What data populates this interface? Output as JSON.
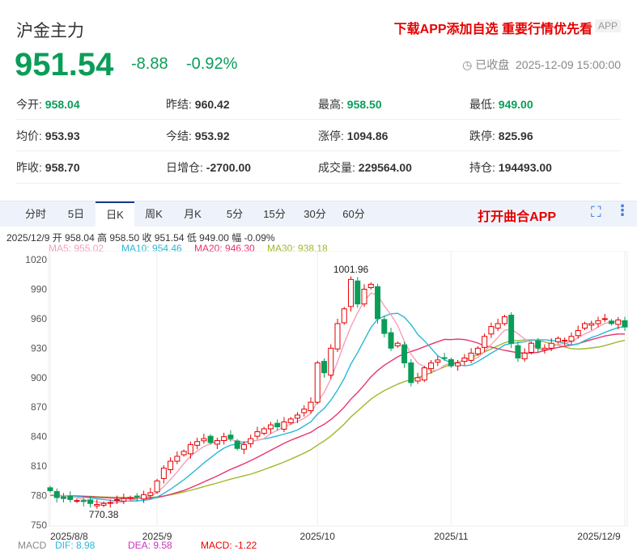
{
  "header": {
    "title": "沪金主力",
    "promo": "下载APP添加自选 重要行情优先看",
    "app_badge": "APP",
    "price": "951.54",
    "change": "-8.88",
    "change_pct": "-0.92%",
    "status": "已收盘",
    "datetime": "2025-12-09 15:00:00"
  },
  "stats": [
    {
      "label": "今开:",
      "value": "958.04",
      "color": "g"
    },
    {
      "label": "昨结:",
      "value": "960.42",
      "color": ""
    },
    {
      "label": "最高:",
      "value": "958.50",
      "color": "g"
    },
    {
      "label": "最低:",
      "value": "949.00",
      "color": "g"
    },
    {
      "label": "均价:",
      "value": "953.93",
      "color": ""
    },
    {
      "label": "今结:",
      "value": "953.92",
      "color": ""
    },
    {
      "label": "涨停:",
      "value": "1094.86",
      "color": ""
    },
    {
      "label": "跌停:",
      "value": "825.96",
      "color": ""
    },
    {
      "label": "昨收:",
      "value": "958.70",
      "color": ""
    },
    {
      "label": "日增仓:",
      "value": "-2700.00",
      "color": ""
    },
    {
      "label": "成交量:",
      "value": "229564.00",
      "color": ""
    },
    {
      "label": "持仓:",
      "value": "194493.00",
      "color": ""
    }
  ],
  "tabs": [
    {
      "label": "分时"
    },
    {
      "label": "5日"
    },
    {
      "label": "日K",
      "active": true
    },
    {
      "label": "周K"
    },
    {
      "label": "月K"
    },
    {
      "label": "5分"
    },
    {
      "label": "15分"
    },
    {
      "label": "30分"
    },
    {
      "label": "60分"
    }
  ],
  "open_app": "打开曲合APP",
  "ohlc_line": "2025/12/9 开 958.04 高 958.50 收 951.54 低 949.00 幅 -0.09%",
  "ma": {
    "ma5": "MA5: 955.02",
    "ma10": "MA10: 954.46",
    "ma20": "MA20: 946.30",
    "ma30": "MA30: 938.18"
  },
  "macd": {
    "label": "MACD",
    "dif": "DIF: 8.98",
    "dea": "DEA: 9.58",
    "macd": "MACD: -1.22"
  },
  "colors": {
    "up": "#e60000",
    "down": "#0a9d58",
    "ma5": "#f4a0b8",
    "ma10": "#28b8d8",
    "ma20": "#e8336e",
    "ma30": "#9cba2a"
  },
  "chart_data": {
    "type": "candlestick",
    "ylim": [
      750,
      1020
    ],
    "yticks": [
      1020,
      990,
      960,
      930,
      900,
      870,
      840,
      810,
      780,
      750
    ],
    "xticks": [
      {
        "label": "2025/8/8",
        "i": 0
      },
      {
        "label": "2025/9",
        "i": 16
      },
      {
        "label": "2025/10",
        "i": 40
      },
      {
        "label": "2025/11",
        "i": 60
      },
      {
        "label": "2025/12/9",
        "i": 86
      }
    ],
    "annotations": [
      {
        "label": "1001.96",
        "i": 45,
        "value": 1001.96
      },
      {
        "label": "770.38",
        "i": 8,
        "value": 770.38
      }
    ],
    "close": [
      785,
      778,
      777,
      776,
      775,
      774,
      772,
      771,
      772,
      773,
      776,
      777,
      778,
      779,
      781,
      783,
      795,
      808,
      815,
      820,
      825,
      832,
      835,
      838,
      834,
      836,
      840,
      838,
      828,
      832,
      838,
      845,
      848,
      852,
      850,
      855,
      858,
      862,
      868,
      875,
      915,
      905,
      930,
      955,
      970,
      1000,
      975,
      990,
      995,
      960,
      945,
      930,
      935,
      915,
      895,
      900,
      910,
      915,
      918,
      920,
      912,
      915,
      920,
      925,
      930,
      942,
      952,
      955,
      962,
      935,
      920,
      925,
      935,
      930,
      930,
      935,
      940,
      938,
      942,
      948,
      955,
      955,
      958,
      960,
      955,
      958.7,
      951.54
    ],
    "ma_init": 780
  }
}
